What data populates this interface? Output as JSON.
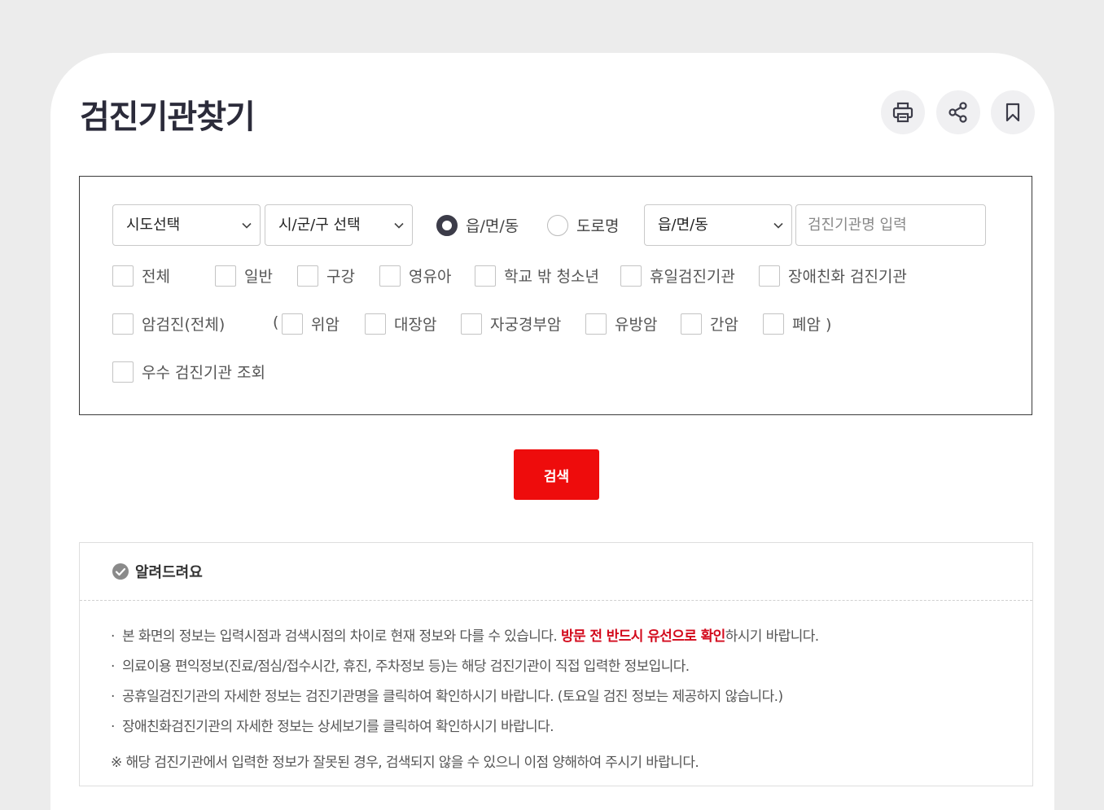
{
  "page": {
    "title": "검진기관찾기"
  },
  "toolbar": {
    "print_icon": "printer-icon",
    "share_icon": "share-icon",
    "bookmark_icon": "bookmark-icon"
  },
  "filters": {
    "sido_select": "시도선택",
    "sigungu_select": "시/군/구 선택",
    "radio_options": [
      {
        "label": "읍/면/동",
        "checked": true
      },
      {
        "label": "도로명",
        "checked": false
      }
    ],
    "eupmyeondong_select": "읍/면/동",
    "name_placeholder": "검진기관명 입력",
    "row1": [
      "전체",
      "일반",
      "구강",
      "영유아",
      "학교 밖 청소년",
      "휴일검진기관",
      "장애친화 검진기관"
    ],
    "cancer_all": "암검진(전체)",
    "cancer_open": "(",
    "cancer_types": [
      "위암",
      "대장암",
      "자궁경부암",
      "유방암",
      "간암",
      "폐암 )"
    ],
    "excellent": "우수 검진기관 조회"
  },
  "search_button": "검색",
  "notice": {
    "title": "알려드려요",
    "bullet": "·",
    "item1_pre": "본 화면의 정보는 입력시점과 검색시점의 차이로 현재 정보와 다를 수 있습니다. ",
    "item1_emph": "방문 전 반드시 유선으로 확인",
    "item1_post": "하시기 바랍니다.",
    "item2": "의료이용 편익정보(진료/점심/접수시간, 휴진, 주차정보 등)는 해당 검진기관이 직접 입력한 정보입니다.",
    "item3": "공휴일검진기관의 자세한 정보는 검진기관명을 클릭하여 확인하시기 바랍니다. (토요일 검진 정보는 제공하지 않습니다.)",
    "item4": "장애친화검진기관의 자세한 정보는 상세보기를 클릭하여 확인하시기 바랍니다.",
    "note": "※ 해당 검진기관에서 입력한 정보가 잘못된 경우, 검색되지 않을 수 있으니 이점 양해하여 주시기 바랍니다."
  },
  "colors": {
    "accent_red": "#ee0c0c",
    "emphasis_red": "#d30a1c",
    "radio_dark": "#3c3c49"
  }
}
